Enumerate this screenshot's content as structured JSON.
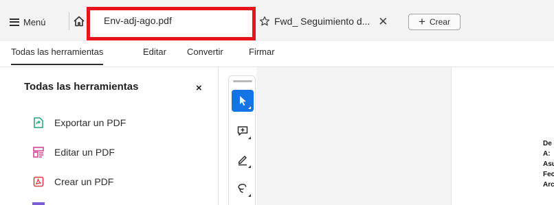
{
  "tabbar": {
    "menu_label": "Menú",
    "active_tab_label": "Env-adj-ago.pdf",
    "second_tab_label": "Fwd_ Seguimiento d...",
    "second_tab_close": "✕",
    "create_label": "Crear",
    "create_plus": "+",
    "highlight_color": "#e8141b"
  },
  "toolbar": {
    "tabs": [
      "Todas las herramientas",
      "Editar",
      "Convertir",
      "Firmar"
    ],
    "active_index": 0
  },
  "panel": {
    "title": "Todas las herramientas",
    "close": "×",
    "tools": [
      {
        "label": "Exportar un PDF",
        "icon": "export-pdf-icon",
        "color": "#2aa07a"
      },
      {
        "label": "Editar un PDF",
        "icon": "edit-pdf-icon",
        "color": "#d43c8c"
      },
      {
        "label": "Crear un PDF",
        "icon": "create-pdf-icon",
        "color": "#e0393e"
      }
    ]
  },
  "strip": {
    "tools": [
      "select-cursor-icon",
      "add-comment-icon",
      "draw-pen-icon",
      "lasso-icon"
    ],
    "active_index": 0,
    "accent": "#1473e6"
  },
  "document": {
    "lines": [
      "De",
      "A:",
      "Asu",
      "Fec",
      "Arc"
    ]
  }
}
